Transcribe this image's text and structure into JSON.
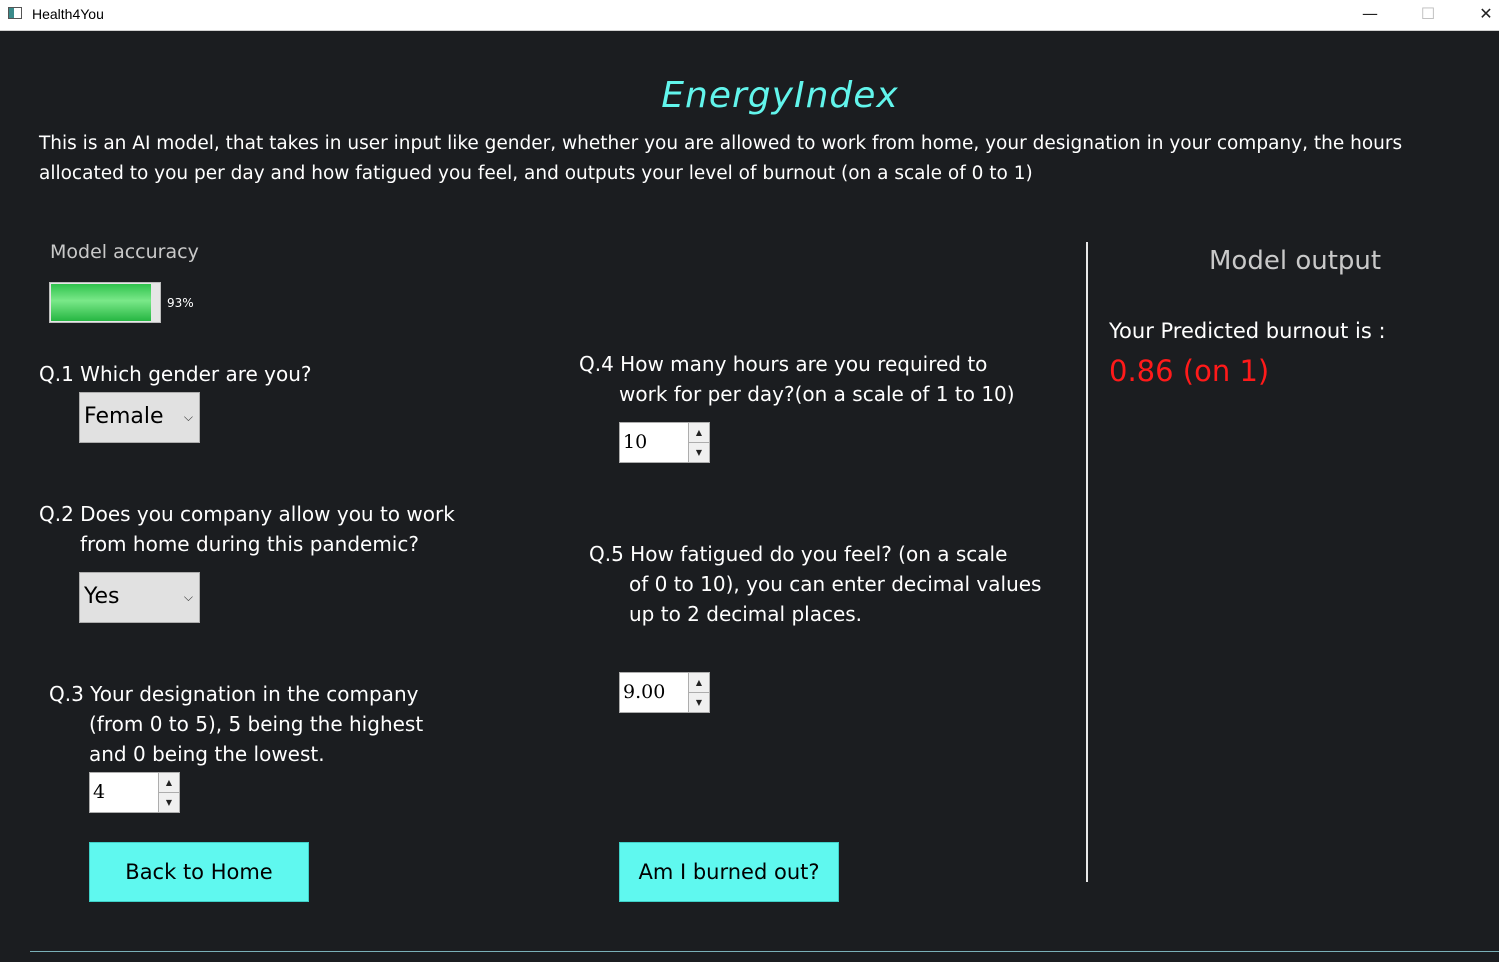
{
  "window": {
    "title": "Health4You",
    "min_icon": "—",
    "max_icon": "☐",
    "close_icon": "✕"
  },
  "header": {
    "title": "EnergyIndex",
    "description": "This is an AI model, that takes in user input like gender, whether you are allowed to work from home, your designation in your company, the hours allocated to you per day and how fatigued you feel, and outputs your level of burnout (on a scale of 0 to 1)"
  },
  "accuracy": {
    "label": "Model accuracy",
    "value": 0.93,
    "text": "93%",
    "bar_color": "#2fc34d"
  },
  "q1": {
    "label": "Q.1 Which gender are you?",
    "selected": "Female"
  },
  "q2": {
    "line1": "Q.2 Does you company allow you to work",
    "line2": "from home during this pandemic?",
    "selected": "Yes"
  },
  "q3": {
    "line1": "Q.3 Your designation in the company",
    "line2": "(from 0 to 5), 5 being the highest",
    "line3": "and 0 being the lowest.",
    "value": "4"
  },
  "q4": {
    "line1": "Q.4 How many hours are you required to",
    "line2": "work for per day?(on a scale of 1 to 10)",
    "value": "10"
  },
  "q5": {
    "line1": "Q.5 How fatigued do you feel? (on a scale",
    "line2": "of 0 to 10), you can enter decimal values",
    "line3": "up to 2 decimal places.",
    "value": "9.00"
  },
  "buttons": {
    "back": "Back to Home",
    "submit": "Am I burned out?"
  },
  "output": {
    "title": "Model output",
    "label": "Your Predicted burnout is :",
    "value": "0.86 (on 1)",
    "value_color": "#ff1a1a"
  },
  "icons": {
    "dropdown": "⌵",
    "spin_up": "▲",
    "spin_down": "▼"
  },
  "colors": {
    "accent": "#5ff8ef",
    "heading": "#62f5ec",
    "background": "#1b1d20"
  }
}
